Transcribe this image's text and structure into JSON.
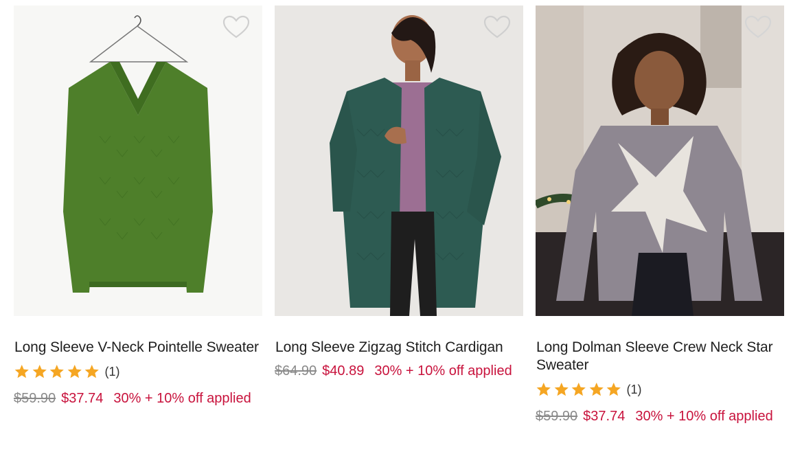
{
  "colors": {
    "sale": "#c8123c",
    "star": "#f5a623",
    "strike": "#8a8a8a"
  },
  "products": [
    {
      "title": "Long Sleeve V-Neck Pointelle Sweater",
      "rating_count": "(1)",
      "rating_value": 5,
      "price_original": "$59.90",
      "price_sale": "$37.74",
      "promo": "30% + 10% off applied",
      "wishlist_icon": "heart-outline-icon"
    },
    {
      "title": "Long Sleeve Zigzag Stitch Cardigan",
      "price_original": "$64.90",
      "price_sale": "$40.89",
      "promo": "30% + 10% off applied",
      "wishlist_icon": "heart-outline-icon"
    },
    {
      "title": "Long Dolman Sleeve Crew Neck Star Sweater",
      "rating_count": "(1)",
      "rating_value": 5,
      "price_original": "$59.90",
      "price_sale": "$37.74",
      "promo": "30% + 10% off applied",
      "wishlist_icon": "heart-outline-icon"
    }
  ]
}
